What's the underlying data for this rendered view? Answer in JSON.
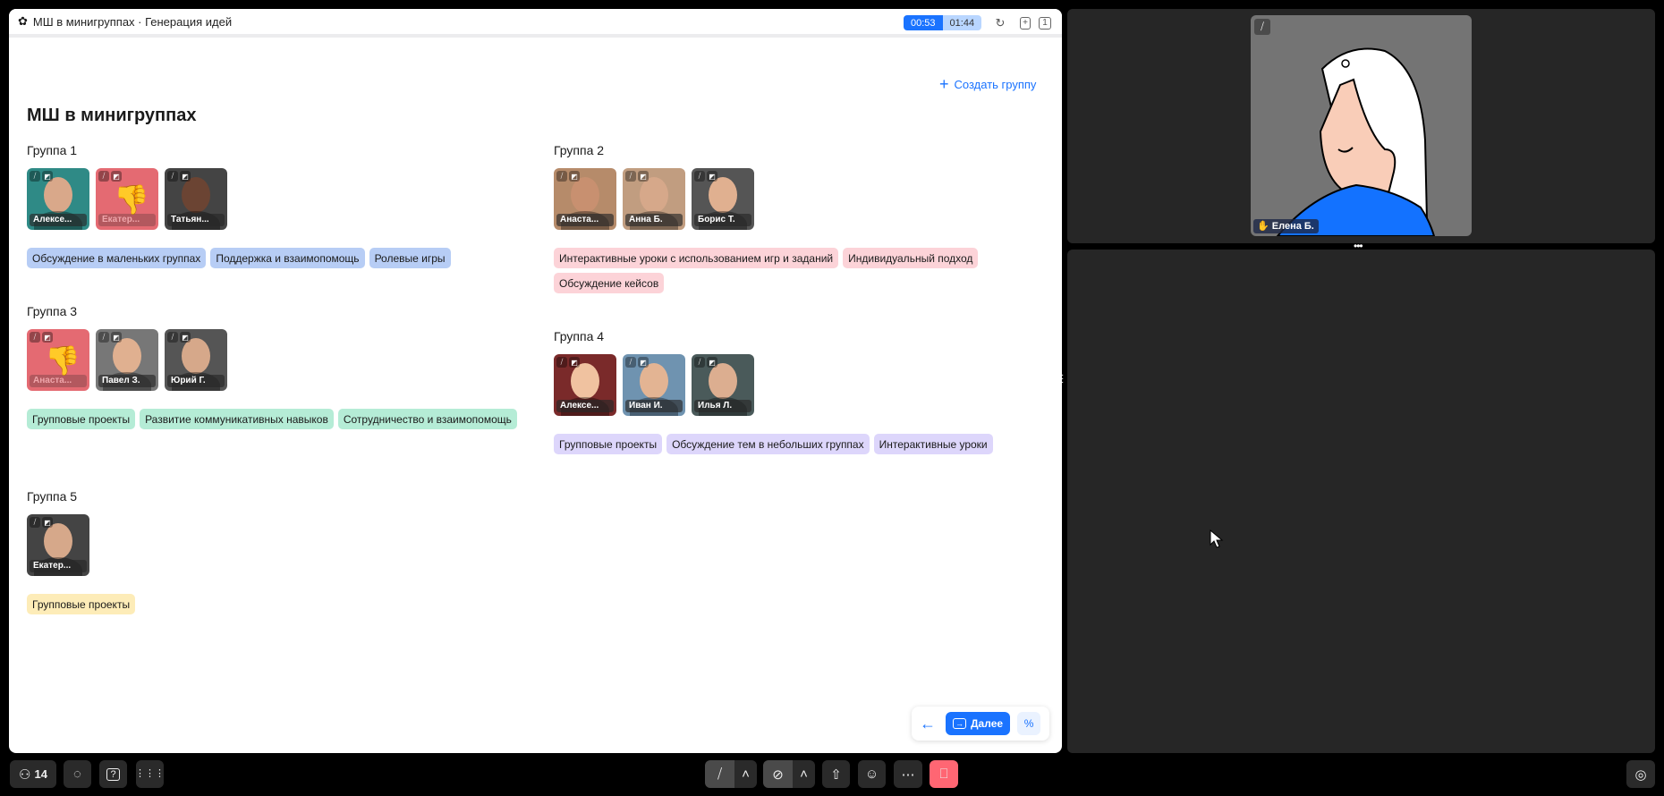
{
  "header": {
    "title": "МШ в минигруппах · Генерация идей",
    "timer_elapsed": "00:53",
    "timer_total": "01:44",
    "page_count": "1"
  },
  "create_group": "Создать группу",
  "page_title": "МШ в минигруппах",
  "groups": [
    {
      "title": "Группа 1",
      "members": [
        {
          "name": "Алексе...",
          "reaction": ""
        },
        {
          "name": "Екатер...",
          "reaction": "👎"
        },
        {
          "name": "Татьян...",
          "reaction": ""
        }
      ],
      "tags": [
        "Обсуждение в маленьких группах",
        "Поддержка и взаимопомощь",
        "Ролевые игры"
      ],
      "color": "#b7cdf5"
    },
    {
      "title": "Группа 2",
      "members": [
        {
          "name": "Анаста...",
          "reaction": ""
        },
        {
          "name": "Анна Б.",
          "reaction": ""
        },
        {
          "name": "Борис Т.",
          "reaction": ""
        }
      ],
      "tags": [
        "Интерактивные уроки с использованием игр и заданий",
        "Индивидуальный подход",
        "Обсуждение кейсов"
      ],
      "color": "#fcd3d8"
    },
    {
      "title": "Группа 3",
      "members": [
        {
          "name": "Анаста...",
          "reaction": "👎"
        },
        {
          "name": "Павел З.",
          "reaction": ""
        },
        {
          "name": "Юрий Г.",
          "reaction": ""
        }
      ],
      "tags": [
        "Групповые проекты",
        "Развитие коммуникативных навыков",
        "Сотрудничество и взаимопомощь"
      ],
      "color": "#b5ecd6"
    },
    {
      "title": "Группа 4",
      "members": [
        {
          "name": "Алексе...",
          "reaction": ""
        },
        {
          "name": "Иван И.",
          "reaction": ""
        },
        {
          "name": "Илья Л.",
          "reaction": ""
        }
      ],
      "tags": [
        "Групповые проекты",
        "Обсуждение тем в небольших группах",
        "Интерактивные уроки"
      ],
      "color": "#ddd6fb"
    },
    {
      "title": "Группа 5",
      "members": [
        {
          "name": "Екатер...",
          "reaction": ""
        }
      ],
      "tags": [
        "Групповые проекты"
      ],
      "color": "#fdecb8"
    }
  ],
  "nav": {
    "next_label": "Далее"
  },
  "video": {
    "name": "Елена Б."
  },
  "toolbar": {
    "participants_count": "14"
  }
}
